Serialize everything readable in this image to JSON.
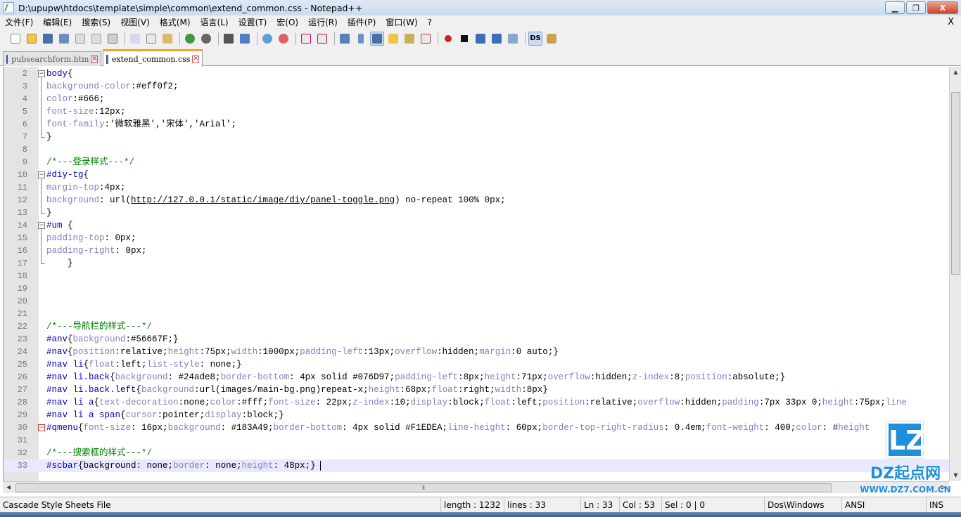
{
  "window": {
    "title": "D:\\upupw\\htdocs\\template\\simple\\common\\extend_common.css - Notepad++",
    "buttons": {
      "minimize": "▁",
      "maximize": "❐",
      "close": "X"
    }
  },
  "menu": {
    "items": [
      "文件(F)",
      "编辑(E)",
      "搜索(S)",
      "视图(V)",
      "格式(M)",
      "语言(L)",
      "设置(T)",
      "宏(O)",
      "运行(R)",
      "插件(P)",
      "窗口(W)",
      "?"
    ],
    "close_label": "X"
  },
  "toolbar": {
    "icons": [
      "new-file-icon",
      "open-file-icon",
      "save-icon",
      "save-all-icon",
      "close-icon",
      "close-all-icon",
      "print-icon",
      "cut-icon",
      "copy-icon",
      "paste-icon",
      "undo-icon",
      "redo-icon",
      "find-icon",
      "replace-icon",
      "zoom-in-icon",
      "zoom-out-icon",
      "sync-vertical-icon",
      "sync-horizontal-icon",
      "word-wrap-icon",
      "show-all-chars-icon",
      "indent-guide-icon",
      "user-defined-lang-icon",
      "doc-map-icon",
      "function-list-icon",
      "record-macro-icon",
      "stop-macro-icon",
      "play-macro-icon",
      "run-macro-multiple-icon",
      "save-macro-icon",
      "ds-icon",
      "plugin-icon"
    ],
    "ds_label": "DS"
  },
  "tabs": [
    {
      "label": "pubsearchform.htm",
      "active": false
    },
    {
      "label": "extend_common.css",
      "active": true
    }
  ],
  "editor": {
    "lines": [
      {
        "num": "2",
        "fold": "open",
        "parts": [
          [
            "sel",
            "body"
          ],
          [
            "str",
            "{"
          ]
        ]
      },
      {
        "num": "3",
        "parts": [
          [
            "prop",
            "background-color"
          ],
          [
            "str",
            ":#eff0f2;"
          ]
        ]
      },
      {
        "num": "4",
        "parts": [
          [
            "prop",
            "color"
          ],
          [
            "str",
            ":#666;"
          ]
        ]
      },
      {
        "num": "5",
        "parts": [
          [
            "prop",
            "font-size"
          ],
          [
            "str",
            ":12px;"
          ]
        ]
      },
      {
        "num": "6",
        "parts": [
          [
            "prop",
            "font-family"
          ],
          [
            "str",
            ":'微软雅黑','宋体','Arial';"
          ]
        ]
      },
      {
        "num": "7",
        "parts": [
          [
            "str",
            "}"
          ]
        ]
      },
      {
        "num": "8",
        "parts": []
      },
      {
        "num": "9",
        "parts": [
          [
            "cmt",
            "/*---登录样式---*/"
          ]
        ]
      },
      {
        "num": "10",
        "fold": "open",
        "parts": [
          [
            "sel",
            "#diy-tg"
          ],
          [
            "str",
            "{"
          ]
        ]
      },
      {
        "num": "11",
        "parts": [
          [
            "prop",
            "margin-top"
          ],
          [
            "str",
            ":4px;"
          ]
        ]
      },
      {
        "num": "12",
        "parts": [
          [
            "prop",
            "background"
          ],
          [
            "str",
            ": url("
          ],
          [
            "url",
            "http://127.0.0.1/static/image/diy/panel-toggle.png"
          ],
          [
            "str",
            ") no-repeat 100% 0px;"
          ]
        ]
      },
      {
        "num": "13",
        "parts": [
          [
            "str",
            "}"
          ]
        ]
      },
      {
        "num": "14",
        "fold": "open",
        "parts": [
          [
            "sel",
            "#um "
          ],
          [
            "str",
            "{"
          ]
        ]
      },
      {
        "num": "15",
        "parts": [
          [
            "prop",
            "padding-top"
          ],
          [
            "str",
            ": 0px;"
          ]
        ]
      },
      {
        "num": "16",
        "parts": [
          [
            "prop",
            "padding-right"
          ],
          [
            "str",
            ": 0px;"
          ]
        ]
      },
      {
        "num": "17",
        "parts": [
          [
            "str",
            "    }"
          ]
        ]
      },
      {
        "num": "18",
        "parts": []
      },
      {
        "num": "19",
        "parts": []
      },
      {
        "num": "20",
        "parts": []
      },
      {
        "num": "21",
        "parts": []
      },
      {
        "num": "22",
        "parts": [
          [
            "cmt",
            "/*---导航栏的样式---*/"
          ]
        ]
      },
      {
        "num": "23",
        "parts": [
          [
            "sel",
            "#anv"
          ],
          [
            "str",
            "{"
          ],
          [
            "prop",
            "background"
          ],
          [
            "str",
            ":#56667F;}"
          ]
        ]
      },
      {
        "num": "24",
        "parts": [
          [
            "sel",
            "#nav"
          ],
          [
            "str",
            "{"
          ],
          [
            "prop",
            "position"
          ],
          [
            "str",
            ":relative;"
          ],
          [
            "prop",
            "height"
          ],
          [
            "str",
            ":75px;"
          ],
          [
            "prop",
            "width"
          ],
          [
            "str",
            ":1000px;"
          ],
          [
            "prop",
            "padding-left"
          ],
          [
            "str",
            ":13px;"
          ],
          [
            "prop",
            "overflow"
          ],
          [
            "str",
            ":hidden;"
          ],
          [
            "prop",
            "margin"
          ],
          [
            "str",
            ":0 auto;}"
          ]
        ]
      },
      {
        "num": "25",
        "parts": [
          [
            "sel",
            "#nav li"
          ],
          [
            "str",
            "{"
          ],
          [
            "prop",
            "float"
          ],
          [
            "str",
            ":left;"
          ],
          [
            "prop",
            "list-style"
          ],
          [
            "str",
            ": none;}"
          ]
        ]
      },
      {
        "num": "26",
        "parts": [
          [
            "sel",
            "#nav li.back"
          ],
          [
            "str",
            "{"
          ],
          [
            "prop",
            "background"
          ],
          [
            "str",
            ": #24ade8;"
          ],
          [
            "prop",
            "border-bottom"
          ],
          [
            "str",
            ": 4px solid #076D97;"
          ],
          [
            "prop",
            "padding-left"
          ],
          [
            "str",
            ":8px;"
          ],
          [
            "prop",
            "height"
          ],
          [
            "str",
            ":71px;"
          ],
          [
            "prop",
            "overflow"
          ],
          [
            "str",
            ":hidden;"
          ],
          [
            "prop",
            "z-index"
          ],
          [
            "str",
            ":8;"
          ],
          [
            "prop",
            "position"
          ],
          [
            "str",
            ":absolute;}"
          ]
        ]
      },
      {
        "num": "27",
        "parts": [
          [
            "sel",
            "#nav li.back.left"
          ],
          [
            "str",
            "{"
          ],
          [
            "prop",
            "background"
          ],
          [
            "str",
            ":url(images/main-bg.png)repeat-x;"
          ],
          [
            "prop",
            "height"
          ],
          [
            "str",
            ":68px;"
          ],
          [
            "prop",
            "float"
          ],
          [
            "str",
            ":right;"
          ],
          [
            "prop",
            "width"
          ],
          [
            "str",
            ":8px}"
          ]
        ]
      },
      {
        "num": "28",
        "parts": [
          [
            "sel",
            "#nav li a"
          ],
          [
            "str",
            "{"
          ],
          [
            "prop",
            "text-decoration"
          ],
          [
            "str",
            ":none;"
          ],
          [
            "prop",
            "color"
          ],
          [
            "str",
            ":#fff;"
          ],
          [
            "prop",
            "font-size"
          ],
          [
            "str",
            ": 22px;"
          ],
          [
            "prop",
            "z-index"
          ],
          [
            "str",
            ":10;"
          ],
          [
            "prop",
            "display"
          ],
          [
            "str",
            ":block;"
          ],
          [
            "prop",
            "float"
          ],
          [
            "str",
            ":left;"
          ],
          [
            "prop",
            "position"
          ],
          [
            "str",
            ":relative;"
          ],
          [
            "prop",
            "overflow"
          ],
          [
            "str",
            ":hidden;"
          ],
          [
            "prop",
            "padding"
          ],
          [
            "str",
            ":7px 33px 0;"
          ],
          [
            "prop",
            "height"
          ],
          [
            "str",
            ":75px;"
          ],
          [
            "prop",
            "line"
          ]
        ]
      },
      {
        "num": "29",
        "parts": [
          [
            "sel",
            "#nav li a span"
          ],
          [
            "str",
            "{"
          ],
          [
            "prop",
            "cursor"
          ],
          [
            "str",
            ":pointer;"
          ],
          [
            "prop",
            "display"
          ],
          [
            "str",
            ":block;}"
          ]
        ]
      },
      {
        "num": "30",
        "fold": "red",
        "parts": [
          [
            "sel",
            "#qmenu"
          ],
          [
            "str",
            "{"
          ],
          [
            "prop",
            "font-size"
          ],
          [
            "str",
            ": 16px;"
          ],
          [
            "prop",
            "background"
          ],
          [
            "str",
            ": #183A49;"
          ],
          [
            "prop",
            "border-bottom"
          ],
          [
            "str",
            ": 4px solid #F1EDEA;"
          ],
          [
            "prop",
            "line-height"
          ],
          [
            "str",
            ": 60px;"
          ],
          [
            "prop",
            "border-top-right-radius"
          ],
          [
            "str",
            ": 0.4em;"
          ],
          [
            "prop",
            "font-weight"
          ],
          [
            "str",
            ": 400;"
          ],
          [
            "prop",
            "color"
          ],
          [
            "str",
            ": #"
          ],
          [
            "prop",
            "height"
          ]
        ]
      },
      {
        "num": "31",
        "parts": []
      },
      {
        "num": "32",
        "parts": [
          [
            "cmt",
            "/*---搜索框的样式---*/"
          ]
        ]
      },
      {
        "num": "33",
        "current": true,
        "parts": [
          [
            "sel",
            "#scbar"
          ],
          [
            "str",
            "{"
          ],
          [
            "str",
            "background: none;"
          ],
          [
            "prop",
            "border"
          ],
          [
            "str",
            ": none;"
          ],
          [
            "prop",
            "height"
          ],
          [
            "str",
            ": 48px;}"
          ]
        ]
      }
    ]
  },
  "status": {
    "file_type": "Cascade Style Sheets File",
    "length": "length : 1232",
    "lines": "lines : 33",
    "ln": "Ln : 33",
    "col": "Col : 53",
    "sel": "Sel : 0 | 0",
    "eol": "Dos\\Windows",
    "encoding": "ANSI",
    "mode": "INS"
  },
  "watermark": {
    "logo_letter": "LZ",
    "brand": "DZ起点网",
    "url": "WWW.DZ7.COM.CN"
  }
}
